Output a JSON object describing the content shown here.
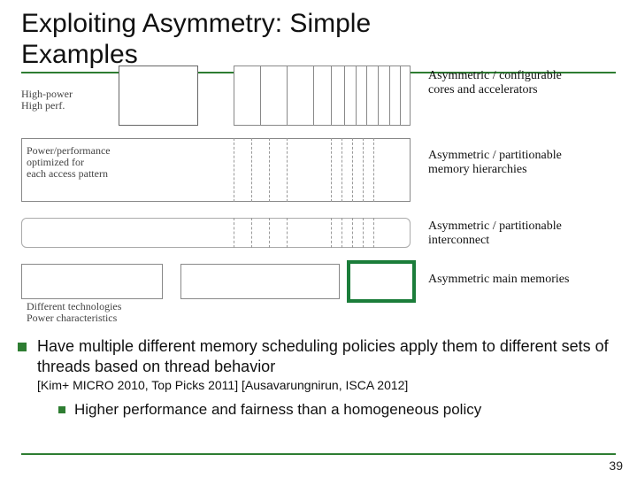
{
  "title_line1": "Exploiting Asymmetry: Simple",
  "title_line2": "Examples",
  "left_labels": {
    "core": "High-power\nHigh perf.",
    "mem_hier": "Power/performance\noptimized for\neach access pattern",
    "mainmem": "Different technologies\nPower characteristics"
  },
  "right_labels": {
    "cores": "Asymmetric / configurable\ncores and accelerators",
    "mem_hier": "Asymmetric / partitionable\nmemory hierarchies",
    "interconnect": "Asymmetric / partitionable\ninterconnect",
    "mainmem": "Asymmetric main memories"
  },
  "bullet1": "Have multiple different memory scheduling policies apply them to different sets of threads based on thread behavior",
  "bullet1_ref": "[Kim+ MICRO 2010, Top Picks 2011] [Ausavarungnirun, ISCA 2012]",
  "bullet2": "Higher performance and fairness than a homogeneous policy",
  "page_number": "39"
}
